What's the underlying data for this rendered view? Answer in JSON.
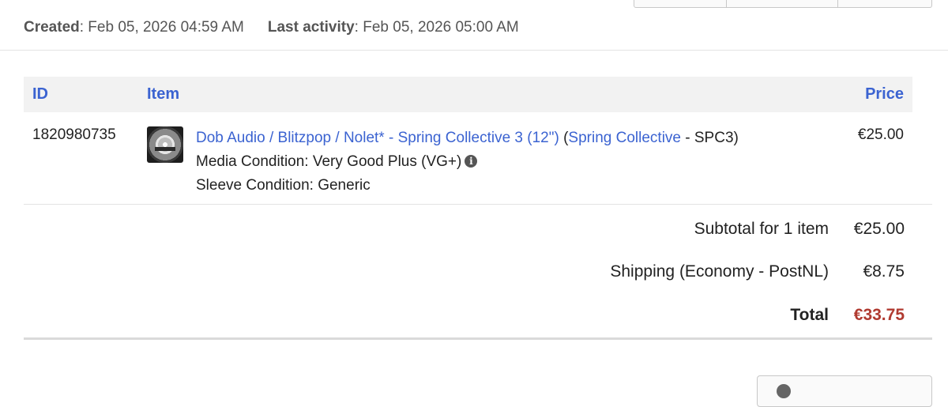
{
  "order_meta": {
    "created_label": "Created",
    "created_value": ": Feb 05, 2026 04:59 AM",
    "last_activity_label": "Last activity",
    "last_activity_value": ": Feb 05, 2026 05:00 AM"
  },
  "table": {
    "headers": {
      "id": "ID",
      "item": "Item",
      "price": "Price"
    },
    "rows": [
      {
        "id": "1820980735",
        "release_title": "Dob Audio / Blitzpop / Nolet* - Spring Collective 3 (12\")",
        "label_open": " (",
        "label_name": "Spring Collective",
        "catalog": " - SPC3)",
        "media_condition": "Media Condition: Very Good Plus (VG+)",
        "sleeve_condition": "Sleeve Condition: Generic",
        "price": "€25.00",
        "info_icon": "info-circle-icon",
        "thumbnail": "record-thumbnail"
      }
    ]
  },
  "summary": {
    "subtotal_label": "Subtotal for 1 item",
    "subtotal_value": "€25.00",
    "shipping_label": "Shipping (Economy - PostNL)",
    "shipping_value": "€8.75",
    "total_label": "Total",
    "total_value": "€33.75"
  },
  "colors": {
    "link": "#3b63d1",
    "total": "#b03a30",
    "header_bg": "#f2f2f2"
  }
}
